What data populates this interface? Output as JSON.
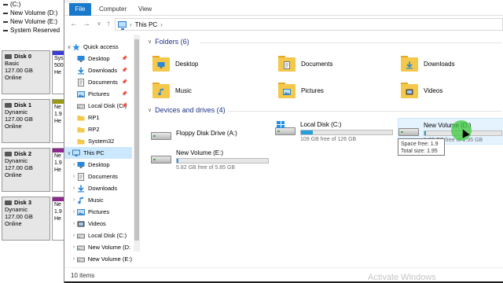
{
  "disk_mgmt": {
    "volumes": [
      "(C:)",
      "New Volume (D:)",
      "New Volume (E:)",
      "System Reserved"
    ],
    "disks": [
      {
        "name": "Disk 0",
        "type": "Basic",
        "size": "127.00 GB",
        "status": "Online",
        "part_label": "Sys",
        "part_size": "500",
        "part_status": "He",
        "stripe": "#3a3ad6"
      },
      {
        "name": "Disk 1",
        "type": "Dynamic",
        "size": "127.00 GB",
        "status": "Online",
        "part_label": "Ne",
        "part_size": "1.9",
        "part_status": "He",
        "stripe": "#9a9a12"
      },
      {
        "name": "Disk 2",
        "type": "Dynamic",
        "size": "127.00 GB",
        "status": "Online",
        "part_label": "Ne",
        "part_size": "1.9",
        "part_status": "He",
        "stripe": "#8e2a8e"
      },
      {
        "name": "Disk 3",
        "type": "Dynamic",
        "size": "127.00 GB",
        "status": "Online",
        "part_label": "Ne",
        "part_size": "1.9",
        "part_status": "He",
        "stripe": "#8e2a8e"
      }
    ]
  },
  "ribbon": {
    "file": "File",
    "computer": "Computer",
    "view": "View"
  },
  "address": {
    "location": "This PC"
  },
  "nav": [
    {
      "label": "Quick access",
      "icon": "star-icon",
      "chev": "∨",
      "indent": 0
    },
    {
      "label": "Desktop",
      "icon": "desktop-icon",
      "pin": true,
      "indent": 1
    },
    {
      "label": "Downloads",
      "icon": "downloads-icon",
      "pin": true,
      "indent": 1
    },
    {
      "label": "Documents",
      "icon": "documents-icon",
      "pin": true,
      "indent": 1
    },
    {
      "label": "Pictures",
      "icon": "pictures-icon",
      "pin": true,
      "indent": 1
    },
    {
      "label": "Local Disk (C:)",
      "icon": "drive-icon",
      "pin": true,
      "indent": 1
    },
    {
      "label": "RP1",
      "icon": "folder-icon",
      "indent": 1
    },
    {
      "label": "RP2",
      "icon": "folder-icon",
      "indent": 1
    },
    {
      "label": "System32",
      "icon": "folder-icon",
      "indent": 1
    },
    {
      "label": "This PC",
      "icon": "pc-icon",
      "chev": "∨",
      "indent": 0,
      "selected": true
    },
    {
      "label": "Desktop",
      "icon": "desktop-icon",
      "chev": "›",
      "indent": 1
    },
    {
      "label": "Documents",
      "icon": "documents-icon",
      "chev": "›",
      "indent": 1
    },
    {
      "label": "Downloads",
      "icon": "downloads-icon",
      "chev": "›",
      "indent": 1
    },
    {
      "label": "Music",
      "icon": "music-icon",
      "chev": "›",
      "indent": 1
    },
    {
      "label": "Pictures",
      "icon": "pictures-icon",
      "chev": "›",
      "indent": 1
    },
    {
      "label": "Videos",
      "icon": "videos-icon",
      "chev": "›",
      "indent": 1
    },
    {
      "label": "Local Disk (C:)",
      "icon": "drive-icon",
      "chev": "›",
      "indent": 1
    },
    {
      "label": "New Volume (D:",
      "icon": "drive-icon",
      "chev": "›",
      "indent": 1
    },
    {
      "label": "New Volume (E:)",
      "icon": "drive-icon",
      "chev": "›",
      "indent": 1
    }
  ],
  "folders": {
    "header": "Folders (6)",
    "items": [
      {
        "label": "Desktop",
        "icon": "desktop-icon"
      },
      {
        "label": "Documents",
        "icon": "documents-icon"
      },
      {
        "label": "Downloads",
        "icon": "downloads-icon"
      },
      {
        "label": "Music",
        "icon": "music-icon"
      },
      {
        "label": "Pictures",
        "icon": "pictures-icon"
      },
      {
        "label": "Videos",
        "icon": "videos-icon"
      }
    ]
  },
  "drives": {
    "header": "Devices and drives (4)",
    "items": [
      {
        "name": "Floppy Disk Drive (A:)",
        "free": "",
        "fill": null
      },
      {
        "name": "Local Disk (C:)",
        "free": "109 GB free of 126 GB",
        "fill": 0.13,
        "windows": true
      },
      {
        "name": "New Volume (D:)",
        "free": "1.92 GB free of 1.95 GB",
        "fill": 0.02,
        "hover": true
      },
      {
        "name": "New Volume (E:)",
        "free": "5.82 GB free of 5.85 GB",
        "fill": 0.01
      }
    ]
  },
  "tooltip": {
    "line1": "Space free: 1.9",
    "line2": "Total size: 1.95"
  },
  "status": {
    "items": "10 items"
  },
  "watermark": "Activate Windows",
  "colors": {
    "accent": "#1979ca",
    "bar": "#26a0da",
    "header": "#1e3287",
    "selected": "#cce8ff"
  }
}
